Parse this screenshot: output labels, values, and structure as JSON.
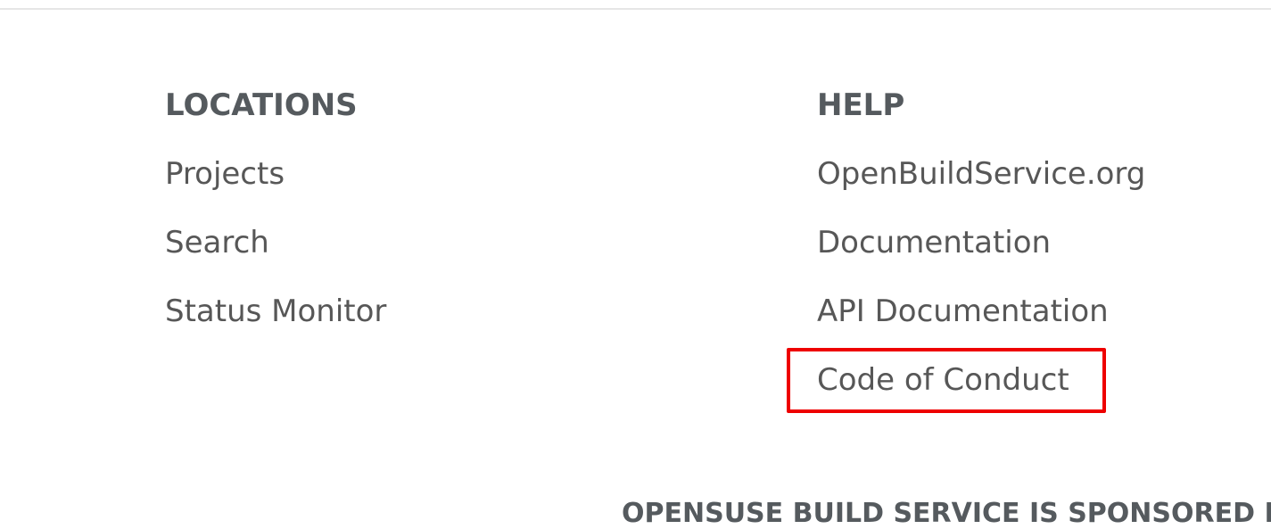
{
  "footer": {
    "locations": {
      "heading": "LOCATIONS",
      "links": [
        "Projects",
        "Search",
        "Status Monitor"
      ]
    },
    "help": {
      "heading": "HELP",
      "links": [
        "OpenBuildService.org",
        "Documentation",
        "API Documentation",
        "Code of Conduct"
      ]
    },
    "sponsor_text": "OPENSUSE BUILD SERVICE IS SPONSORED BY",
    "highlight_color": "#ee0000"
  }
}
